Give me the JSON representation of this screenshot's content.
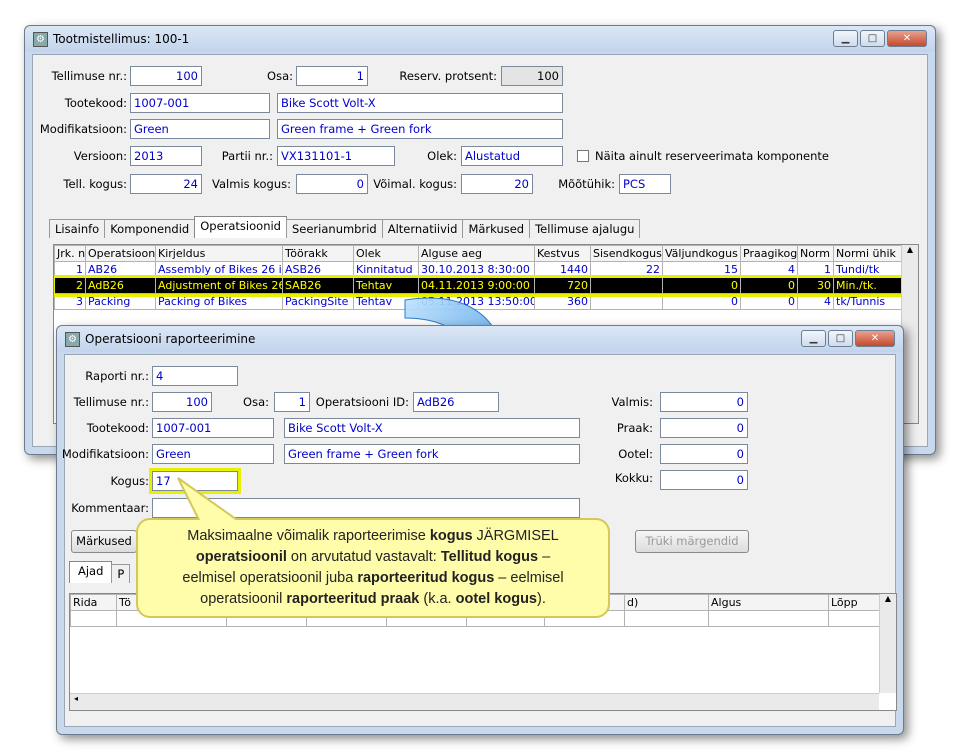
{
  "main": {
    "title": "Tootmistellimus: 100-1",
    "fields": {
      "tellimuse_nr_label": "Tellimuse nr.:",
      "tellimuse_nr": "100",
      "osa_label": "Osa:",
      "osa": "1",
      "reserv_label": "Reserv. protsent:",
      "reserv": "100",
      "tootekood_label": "Tootekood:",
      "tootekood": "1007-001",
      "tootekood_desc": "Bike Scott Volt-X",
      "modifikatsioon_label": "Modifikatsioon:",
      "modifikatsioon": "Green",
      "modifikatsioon_desc": "Green frame + Green fork",
      "versioon_label": "Versioon:",
      "versioon": "2013",
      "partii_label": "Partii nr.:",
      "partii": "VX131101-1",
      "olek_label": "Olek:",
      "olek": "Alustatud",
      "naita_label": "Näita ainult reserveerimata komponente",
      "tell_kogus_label": "Tell. kogus:",
      "tell_kogus": "24",
      "valmis_kogus_label": "Valmis kogus:",
      "valmis_kogus": "0",
      "voimal_kogus_label": "Võimal. kogus:",
      "voimal_kogus": "20",
      "mootuhik_label": "Mõõtühik:",
      "mootuhik": "PCS"
    },
    "tabs": [
      "Lisainfo",
      "Komponendid",
      "Operatsioonid",
      "Seerianumbrid",
      "Alternatiivid",
      "Märkused",
      "Tellimuse ajalugu"
    ],
    "ops_columns": [
      "Jrk. nr",
      "Operatsioonid",
      "Kirjeldus",
      "Töörakk",
      "Olek",
      "Alguse aeg",
      "Kestvus",
      "Sisendkogus",
      "Väljundkogus",
      "Praagikogus",
      "Norm",
      "Normi ühik"
    ],
    "ops_rows": [
      [
        "1",
        "AB26",
        "Assembly of Bikes 26 in",
        "ASB26",
        "Kinnitatud",
        "30.10.2013 8:30:00",
        "1440",
        "22",
        "15",
        "4",
        "1",
        "Tundi/tk"
      ],
      [
        "2",
        "AdB26",
        "Adjustment of Bikes 26",
        "SAB26",
        "Tehtav",
        "04.11.2013 9:00:00",
        "720",
        "",
        "0",
        "0",
        "30",
        "Min./tk."
      ],
      [
        "3",
        "Packing",
        "Packing of Bikes",
        "PackingSite",
        "Tehtav",
        "05.11.2013 13:50:00",
        "360",
        "",
        "0",
        "0",
        "4",
        "tk/Tunnis"
      ]
    ]
  },
  "dialog": {
    "title": "Operatsiooni raporteerimine",
    "raporti_nr_label": "Raporti nr.:",
    "raporti_nr": "4",
    "tellimuse_nr_label": "Tellimuse nr.:",
    "tellimuse_nr": "100",
    "osa_label": "Osa:",
    "osa": "1",
    "op_id_label": "Operatsiooni ID:",
    "op_id": "AdB26",
    "tootekood_label": "Tootekood:",
    "tootekood": "1007-001",
    "tootekood_desc": "Bike Scott Volt-X",
    "modifikatsioon_label": "Modifikatsioon:",
    "modifikatsioon": "Green",
    "modifikatsioon_desc": "Green frame + Green fork",
    "kogus_label": "Kogus:",
    "kogus": "17",
    "kommentaar_label": "Kommentaar:",
    "kommentaar": "",
    "valmis_label": "Valmis:",
    "valmis": "0",
    "praak_label": "Praak:",
    "praak": "0",
    "ootel_label": "Ootel:",
    "ootel": "0",
    "kokku_label": "Kokku:",
    "kokku": "0",
    "markused_btn": "Märkused",
    "truki_btn": "Trüki märgendid",
    "tabs": [
      "Ajad",
      "P"
    ],
    "grid_columns": [
      "Rida",
      "Tö",
      "",
      "",
      "",
      "",
      "",
      "d)",
      "Algus",
      "Lõpp"
    ]
  },
  "callout": {
    "l1a": "Maksimaalne võimalik raporteerimise ",
    "l1b": "kogus",
    "l1c": " JÄRGMISEL",
    "l2a": "operatsioonil",
    "l2b": " on arvutatud vastavalt: ",
    "l2c": "Tellitud kogus",
    "l2d": " –",
    "l3a": "eelmisel operatsioonil juba ",
    "l3b": "raporteeritud kogus",
    "l3c": " – eelmisel",
    "l4a": "operatsioonil ",
    "l4b": "raporteeritud praak",
    "l4c": " (k.a. ",
    "l4d": "ootel kogus",
    "l4e": ")."
  },
  "colors": {
    "highlight": "#ffff00",
    "arrow": "#2a8fe0",
    "callout_bg": "#fffdaa"
  }
}
